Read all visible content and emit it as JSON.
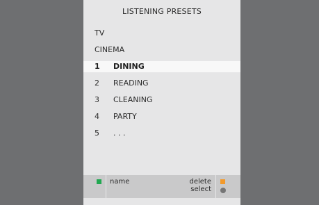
{
  "menu": {
    "title": "LISTENING  PRESETS",
    "sources": [
      "TV",
      "CINEMA"
    ],
    "presets": [
      {
        "number": "1",
        "label": "DINING",
        "selected": true
      },
      {
        "number": "2",
        "label": "READING",
        "selected": false
      },
      {
        "number": "3",
        "label": "CLEANING",
        "selected": false
      },
      {
        "number": "4",
        "label": "PARTY",
        "selected": false
      },
      {
        "number": "5",
        "label": ". . .",
        "selected": false
      }
    ]
  },
  "footer": {
    "green_label": "name",
    "orange_label": "delete",
    "select_label": "select",
    "colors": {
      "green": "#22a851",
      "orange": "#f39a2b",
      "grey": "#767676"
    },
    "icons": {
      "green": "green-square-icon",
      "orange": "orange-square-icon",
      "center": "grey-dot-icon"
    }
  }
}
